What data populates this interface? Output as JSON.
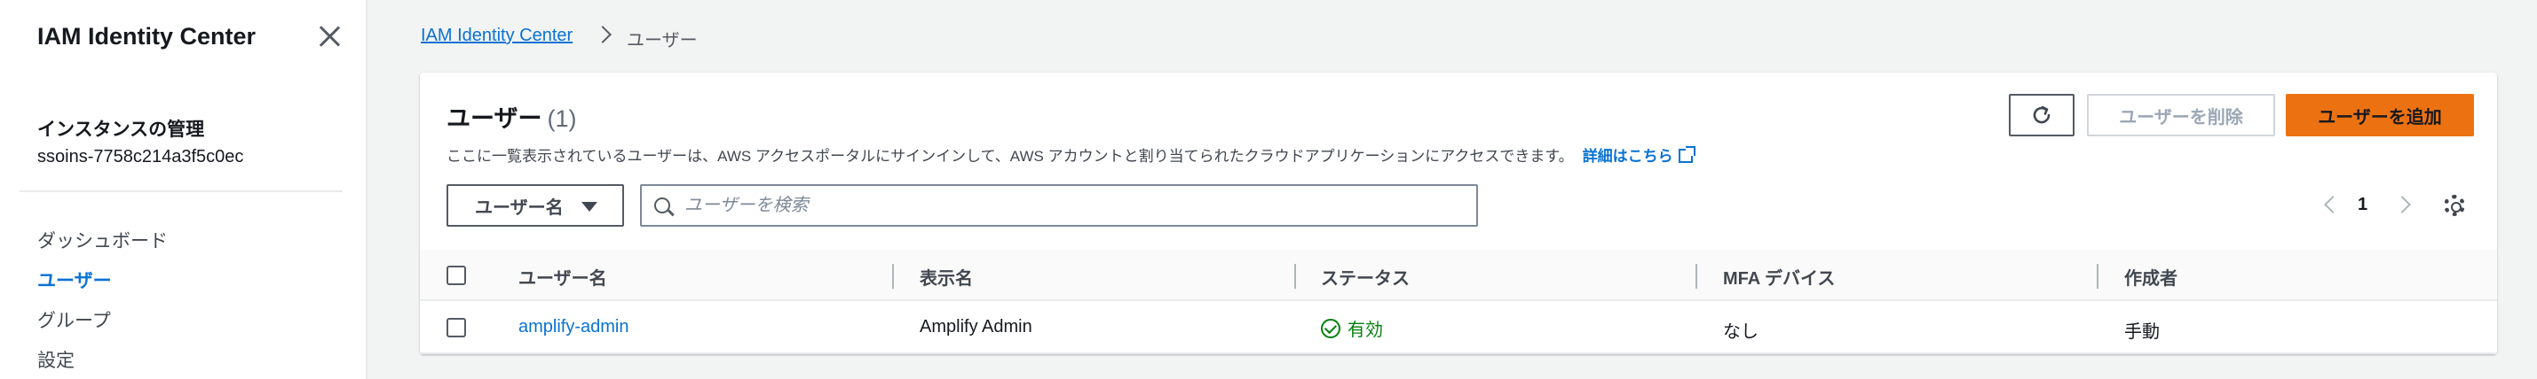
{
  "sidebar": {
    "title": "IAM Identity Center",
    "section_title": "インスタンスの管理",
    "instance_id": "ssoins-7758c214a3f5c0ec",
    "items": [
      {
        "label": "ダッシュボード",
        "active": false
      },
      {
        "label": "ユーザー",
        "active": true
      },
      {
        "label": "グループ",
        "active": false
      },
      {
        "label": "設定",
        "active": false
      }
    ]
  },
  "breadcrumb": {
    "root": "IAM Identity Center",
    "current": "ユーザー"
  },
  "users_panel": {
    "title": "ユーザー",
    "count": "(1)",
    "description": "ここに一覧表示されているユーザーは、AWS アクセスポータルにサインインして、AWS アカウントと割り当てられたクラウドアプリケーションにアクセスできます。",
    "learn_more": "詳細はこちら",
    "delete_label": "ユーザーを削除",
    "add_label": "ユーザーを追加",
    "filter_property": "ユーザー名",
    "search_placeholder": "ユーザーを検索",
    "search_value": "",
    "page": "1",
    "columns": [
      "ユーザー名",
      "表示名",
      "ステータス",
      "MFA デバイス",
      "作成者"
    ],
    "rows": [
      {
        "username": "amplify-admin",
        "display_name": "Amplify Admin",
        "status": "有効",
        "mfa": "なし",
        "created_by": "手動"
      }
    ]
  },
  "colors": {
    "accent": "#0972d3",
    "primary_button": "#ec7211",
    "status_ok": "#037f0c"
  },
  "icons": [
    "close-icon",
    "chevron-right-icon",
    "external-link-icon",
    "refresh-icon",
    "caret-down-icon",
    "search-icon",
    "chevron-left-icon",
    "chevron-right-icon",
    "gear-icon",
    "check-circle-icon"
  ]
}
